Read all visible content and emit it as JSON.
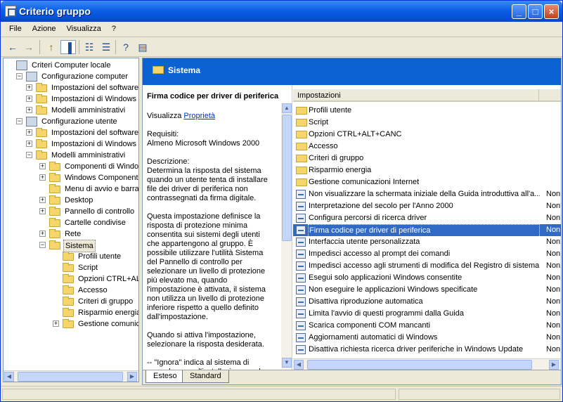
{
  "window": {
    "title": "Criterio gruppo",
    "minimize_glyph": "_",
    "maximize_glyph": "□",
    "close_glyph": "×"
  },
  "menu": [
    "File",
    "Azione",
    "Visualizza",
    "?"
  ],
  "tree": [
    {
      "label": "Criteri Computer locale",
      "level": 0,
      "expander": "",
      "icon": "policy-icon"
    },
    {
      "label": "Configurazione computer",
      "level": 1,
      "expander": "−",
      "icon": "computer-icon"
    },
    {
      "label": "Impostazioni del software",
      "level": 2,
      "expander": "+",
      "icon": "folder-icon"
    },
    {
      "label": "Impostazioni di Windows",
      "level": 2,
      "expander": "+",
      "icon": "folder-icon"
    },
    {
      "label": "Modelli amministrativi",
      "level": 2,
      "expander": "+",
      "icon": "folder-icon"
    },
    {
      "label": "Configurazione utente",
      "level": 1,
      "expander": "−",
      "icon": "user-icon"
    },
    {
      "label": "Impostazioni del software",
      "level": 2,
      "expander": "+",
      "icon": "folder-icon"
    },
    {
      "label": "Impostazioni di Windows",
      "level": 2,
      "expander": "+",
      "icon": "folder-icon"
    },
    {
      "label": "Modelli amministrativi",
      "level": 2,
      "expander": "−",
      "icon": "folder-icon"
    },
    {
      "label": "Componenti di Window",
      "level": 3,
      "expander": "+",
      "icon": "folder-icon"
    },
    {
      "label": "Windows Components",
      "level": 3,
      "expander": "+",
      "icon": "folder-icon"
    },
    {
      "label": "Menu di avvio e barra c",
      "level": 3,
      "expander": "",
      "icon": "folder-icon"
    },
    {
      "label": "Desktop",
      "level": 3,
      "expander": "+",
      "icon": "folder-icon"
    },
    {
      "label": "Pannello di controllo",
      "level": 3,
      "expander": "+",
      "icon": "folder-icon"
    },
    {
      "label": "Cartelle condivise",
      "level": 3,
      "expander": "",
      "icon": "folder-icon"
    },
    {
      "label": "Rete",
      "level": 3,
      "expander": "+",
      "icon": "folder-icon"
    },
    {
      "label": "Sistema",
      "level": 3,
      "expander": "−",
      "icon": "folder-icon",
      "selected": true
    },
    {
      "label": "Profili utente",
      "level": 4,
      "expander": "",
      "icon": "folder-icon"
    },
    {
      "label": "Script",
      "level": 4,
      "expander": "",
      "icon": "folder-icon"
    },
    {
      "label": "Opzioni CTRL+ALT+",
      "level": 4,
      "expander": "",
      "icon": "folder-icon"
    },
    {
      "label": "Accesso",
      "level": 4,
      "expander": "",
      "icon": "folder-icon"
    },
    {
      "label": "Criteri di gruppo",
      "level": 4,
      "expander": "",
      "icon": "folder-icon"
    },
    {
      "label": "Risparmio energia",
      "level": 4,
      "expander": "",
      "icon": "folder-icon"
    },
    {
      "label": "Gestione comunica",
      "level": 4,
      "expander": "+",
      "icon": "folder-icon"
    }
  ],
  "pane": {
    "header_title": "Sistema",
    "desc_title": "Firma codice per driver di periferica",
    "show_prefix": "Visualizza ",
    "show_link": "Proprietà",
    "requirements_label": "Requisiti:",
    "requirements_text": "Almeno Microsoft Windows 2000",
    "description_label": "Descrizione:",
    "description_p1": "Determina la risposta del sistema quando un utente tenta di installare file dei driver di periferica non contrassegnati da firma digitale.",
    "description_p2": "Questa impostazione definisce la risposta di protezione minima consentita sui sistemi degli utenti che appartengono al gruppo. È possibile utilizzare l'utilità Sistema del Pannello di controllo per selezionare un livello di protezione più elevato ma, quando l'impostazione è attivata, il sistema non utilizza un livello di protezione inferiore rispetto a quello definito dall'impostazione.",
    "description_p3": "Quando si attiva l'impostazione, selezionare la risposta desiderata.",
    "description_p4": "--  \"Ignora\" indica al sistema di procedere con l'installazione anche in"
  },
  "list": {
    "col_settings": "Impostazioni",
    "col_state": "",
    "rows": [
      {
        "name": "Profili utente",
        "type": "folder",
        "state": ""
      },
      {
        "name": "Script",
        "type": "folder",
        "state": ""
      },
      {
        "name": "Opzioni CTRL+ALT+CANC",
        "type": "folder",
        "state": ""
      },
      {
        "name": "Accesso",
        "type": "folder",
        "state": ""
      },
      {
        "name": "Criteri di gruppo",
        "type": "folder",
        "state": ""
      },
      {
        "name": "Risparmio energia",
        "type": "folder",
        "state": ""
      },
      {
        "name": "Gestione comunicazioni Internet",
        "type": "folder",
        "state": ""
      },
      {
        "name": "Non visualizzare la schermata iniziale della Guida introduttiva all'a...",
        "type": "setting",
        "state": "Non"
      },
      {
        "name": "Interpretazione del secolo per l'Anno 2000",
        "type": "setting",
        "state": "Non"
      },
      {
        "name": "Configura percorsi di ricerca driver",
        "type": "setting",
        "state": "Non"
      },
      {
        "name": "Firma codice per driver di periferica",
        "type": "setting",
        "state": "Non",
        "selected": true
      },
      {
        "name": "Interfaccia utente personalizzata",
        "type": "setting",
        "state": "Non"
      },
      {
        "name": "Impedisci accesso al prompt dei comandi",
        "type": "setting",
        "state": "Non"
      },
      {
        "name": "Impedisci accesso agli strumenti di modifica del Registro di sistema",
        "type": "setting",
        "state": "Non"
      },
      {
        "name": "Esegui solo applicazioni Windows consentite",
        "type": "setting",
        "state": "Non"
      },
      {
        "name": "Non eseguire le applicazioni Windows specificate",
        "type": "setting",
        "state": "Non"
      },
      {
        "name": "Disattiva riproduzione automatica",
        "type": "setting",
        "state": "Non"
      },
      {
        "name": "Limita l'avvio di questi programmi dalla Guida",
        "type": "setting",
        "state": "Non"
      },
      {
        "name": "Scarica componenti COM mancanti",
        "type": "setting",
        "state": "Non"
      },
      {
        "name": "Aggiornamenti automatici di Windows",
        "type": "setting",
        "state": "Non"
      },
      {
        "name": "Disattiva richiesta ricerca driver periferiche in Windows Update",
        "type": "setting",
        "state": "Non"
      }
    ]
  },
  "tabs": [
    "Esteso",
    "Standard"
  ],
  "toolbar_icons": [
    "back-icon",
    "forward-icon",
    "up-folder-icon",
    "show-tree-icon",
    "properties-icon",
    "export-list-icon",
    "help-icon",
    "console-icon"
  ],
  "colors": {
    "titlebar": "#0b5fe5",
    "header_band": "#0c61d3",
    "selection": "#316ac5"
  }
}
